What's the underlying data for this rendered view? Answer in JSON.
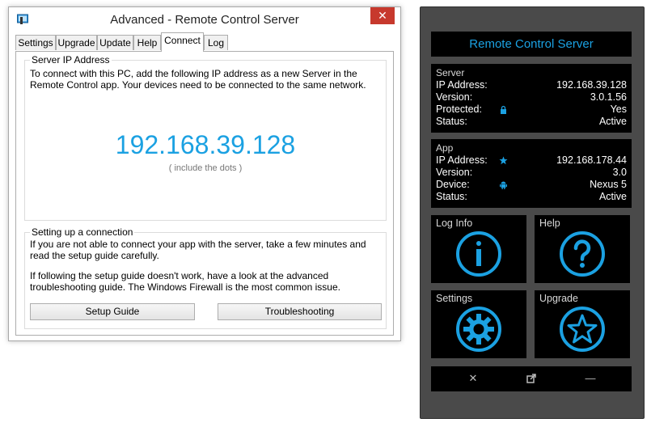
{
  "window": {
    "title": "Advanced - Remote Control Server",
    "close_glyph": "✕",
    "app_icon": "remote-control-icon"
  },
  "tabs": [
    {
      "label": "Settings"
    },
    {
      "label": "Upgrade"
    },
    {
      "label": "Update"
    },
    {
      "label": "Help"
    },
    {
      "label": "Connect",
      "active": true
    },
    {
      "label": "Log"
    }
  ],
  "server_ip_group": {
    "title": "Server IP Address",
    "description": "To connect with this PC, add the following IP address as a new Server in the Remote Control app. Your devices need to be connected to the same network.",
    "ip": "192.168.39.128",
    "hint": "( include the dots )"
  },
  "setup_group": {
    "title": "Setting up a connection",
    "text1": "If you are not able to connect your app with the server, take a few minutes and read the setup guide carefully.",
    "text2": "If following the setup guide doesn't work, have a look at the advanced troubleshooting guide. The Windows Firewall is the most common issue.",
    "setup_button": "Setup Guide",
    "troubleshoot_button": "Troubleshooting"
  },
  "panel": {
    "title": "Remote Control Server",
    "server": {
      "heading": "Server",
      "rows": [
        {
          "label": "IP Address:",
          "value": "192.168.39.128"
        },
        {
          "label": "Version:",
          "value": "3.0.1.56"
        },
        {
          "label": "Protected:",
          "value": "Yes",
          "icon": "lock-icon"
        },
        {
          "label": "Status:",
          "value": "Active"
        }
      ]
    },
    "app": {
      "heading": "App",
      "rows": [
        {
          "label": "IP Address:",
          "value": "192.168.178.44",
          "icon": "star-icon"
        },
        {
          "label": "Version:",
          "value": "3.0"
        },
        {
          "label": "Device:",
          "value": "Nexus 5",
          "icon": "android-icon"
        },
        {
          "label": "Status:",
          "value": "Active"
        }
      ]
    },
    "tiles": [
      {
        "label": "Log Info",
        "icon": "info-icon"
      },
      {
        "label": "Help",
        "icon": "question-icon"
      },
      {
        "label": "Settings",
        "icon": "gear-icon"
      },
      {
        "label": "Upgrade",
        "icon": "star-icon"
      }
    ],
    "bottom_bar": {
      "close_glyph": "✕",
      "popout_icon": "popout-icon",
      "minimize_glyph": "—"
    },
    "accent_color": "#1ba1e2"
  }
}
